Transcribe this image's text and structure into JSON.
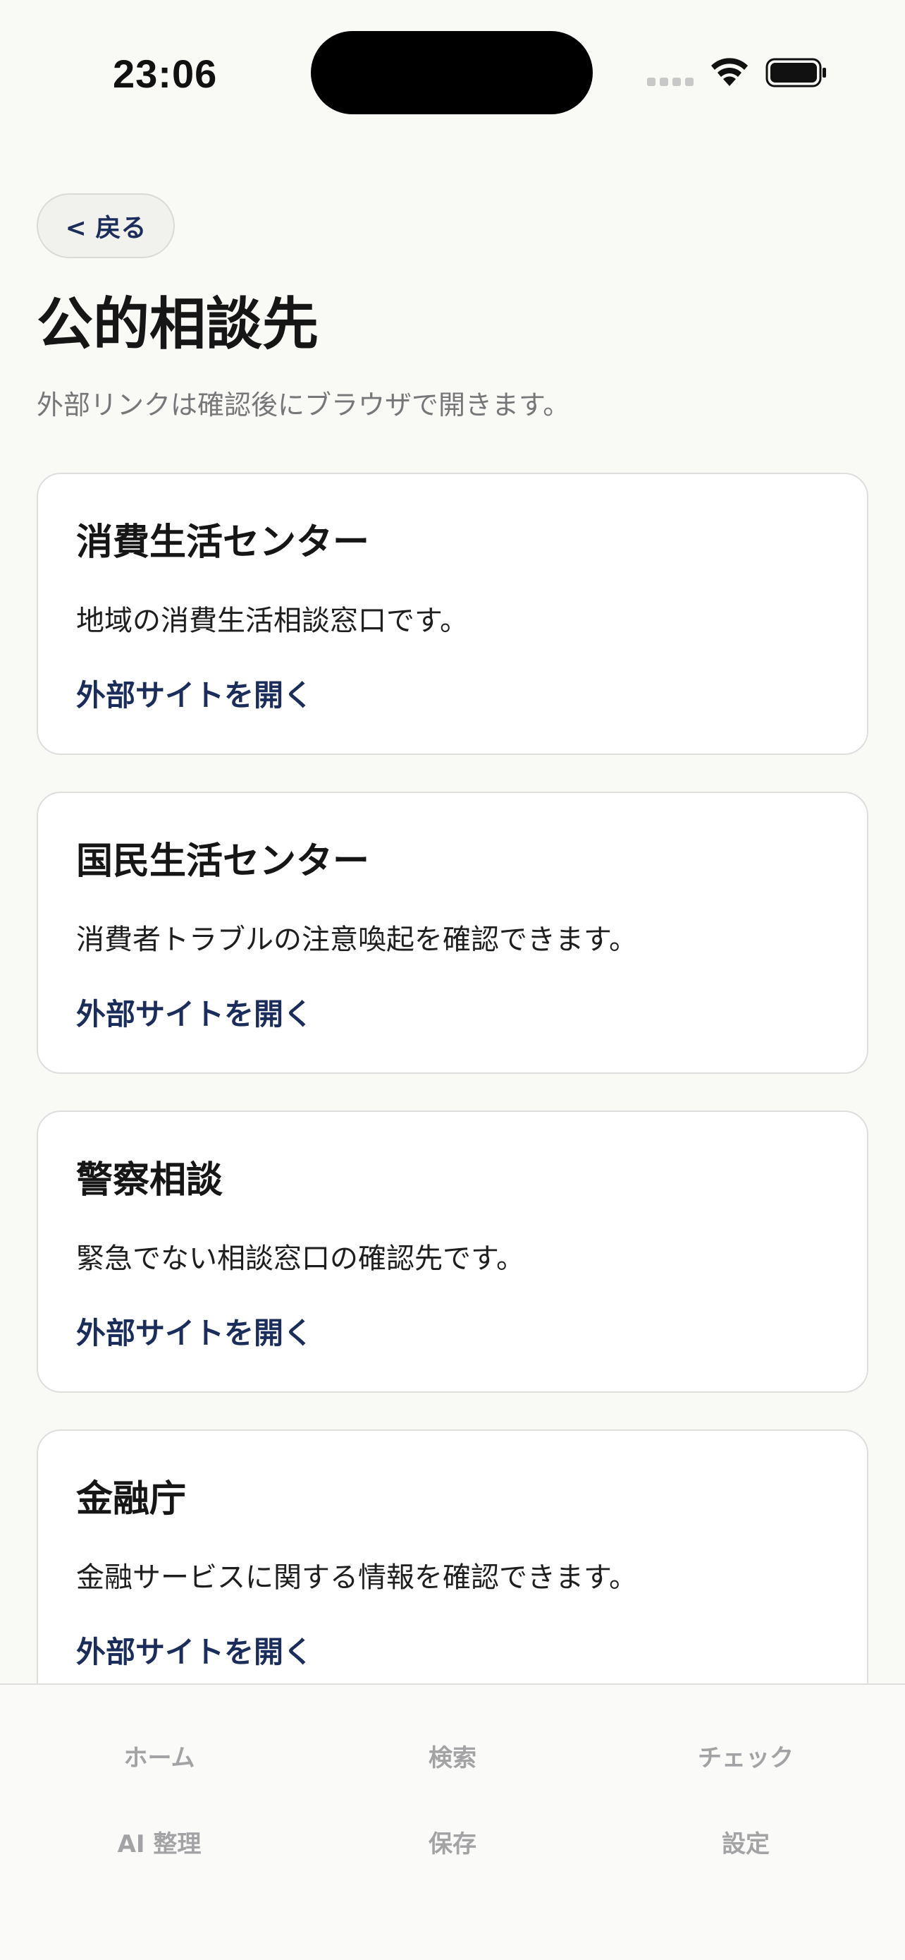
{
  "status_bar": {
    "time": "23:06",
    "icons": [
      "signal-dots-icon",
      "wifi-icon",
      "battery-icon"
    ]
  },
  "header": {
    "back_label": "< 戻る",
    "title": "公的相談先",
    "subtitle": "外部リンクは確認後にブラウザで開きます。"
  },
  "cards": [
    {
      "title": "消費生活センター",
      "description": "地域の消費生活相談窓口です。",
      "link_label": "外部サイトを開く"
    },
    {
      "title": "国民生活センター",
      "description": "消費者トラブルの注意喚起を確認できます。",
      "link_label": "外部サイトを開く"
    },
    {
      "title": "警察相談",
      "description": "緊急でない相談窓口の確認先です。",
      "link_label": "外部サイトを開く"
    },
    {
      "title": "金融庁",
      "description": "金融サービスに関する情報を確認できます。",
      "link_label": "外部サイトを開く"
    }
  ],
  "tab_bar": {
    "items": [
      {
        "label": "ホーム"
      },
      {
        "label": "検索"
      },
      {
        "label": "チェック"
      },
      {
        "label": "AI 整理"
      },
      {
        "label": "保存"
      },
      {
        "label": "設定"
      }
    ]
  },
  "colors": {
    "background": "#f9f9f6",
    "accent_link": "#1b2d5a",
    "tab_inactive": "#a3a3a6"
  }
}
